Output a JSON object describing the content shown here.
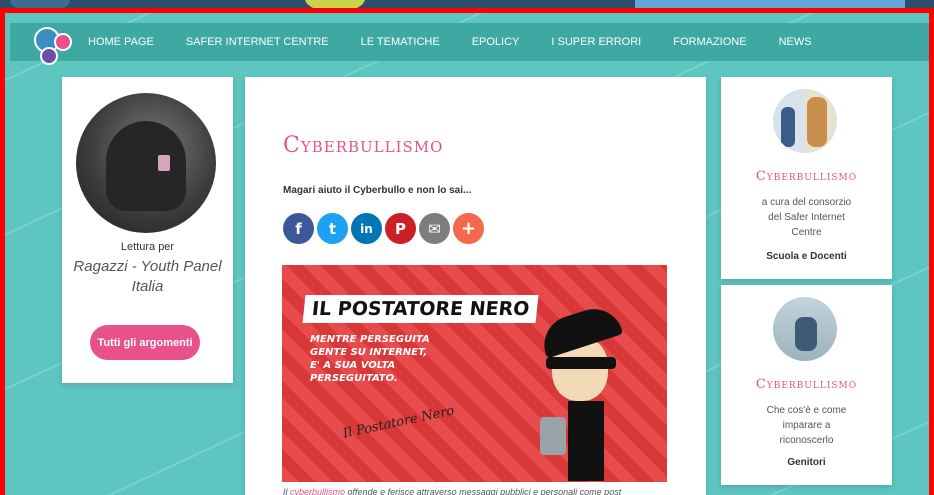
{
  "nav": {
    "items": [
      "HOME PAGE",
      "SAFER INTERNET CENTRE",
      "LE TEMATICHE",
      "EPOLICY",
      "I SUPER ERRORI",
      "FORMAZIONE",
      "NEWS"
    ]
  },
  "left_card": {
    "reading_for": "Lettura per",
    "reader": "Ragazzi - Youth Panel Italia",
    "all_topics_button": "Tutti gli argomenti"
  },
  "article": {
    "title": "Cyberbullismo",
    "subtitle": "Magari aiuto il Cyberbullo e non lo sai...",
    "share_icons": [
      {
        "name": "facebook-icon",
        "glyph": "f",
        "color": "#3b5998"
      },
      {
        "name": "twitter-icon",
        "glyph": "t",
        "color": "#1da1f2"
      },
      {
        "name": "linkedin-icon",
        "glyph": "in",
        "color": "#0077b5"
      },
      {
        "name": "pinterest-icon",
        "glyph": "P",
        "color": "#cb2027"
      },
      {
        "name": "email-icon",
        "glyph": "✉",
        "color": "#7d7d7d"
      },
      {
        "name": "more-share-icon",
        "glyph": "+",
        "color": "#f4694c"
      }
    ],
    "hero": {
      "banner": "IL POSTATORE NERO",
      "line1": "MENTRE PERSEGUITA",
      "line2": "GENTE SU INTERNET,",
      "line3": "E' A SUA VOLTA",
      "line4": "PERSEGUITATO.",
      "signature": "Il Postatore Nero"
    },
    "caption_prefix": "Il ",
    "caption_highlight": "cyberbullismo",
    "caption_rest": " offende e ferisce attraverso messaggi pubblici e personali come post"
  },
  "side_cards": [
    {
      "title": "Cyberbullismo",
      "desc_line1": "a cura del consorzio",
      "desc_line2": "del Safer Internet",
      "desc_line3": "Centre",
      "audience": "Scuola e Docenti"
    },
    {
      "title": "Cyberbullismo",
      "desc_line1": "Che cos'è e come",
      "desc_line2": "imparare a",
      "desc_line3": "riconoscerlo",
      "audience": "Genitori"
    }
  ]
}
